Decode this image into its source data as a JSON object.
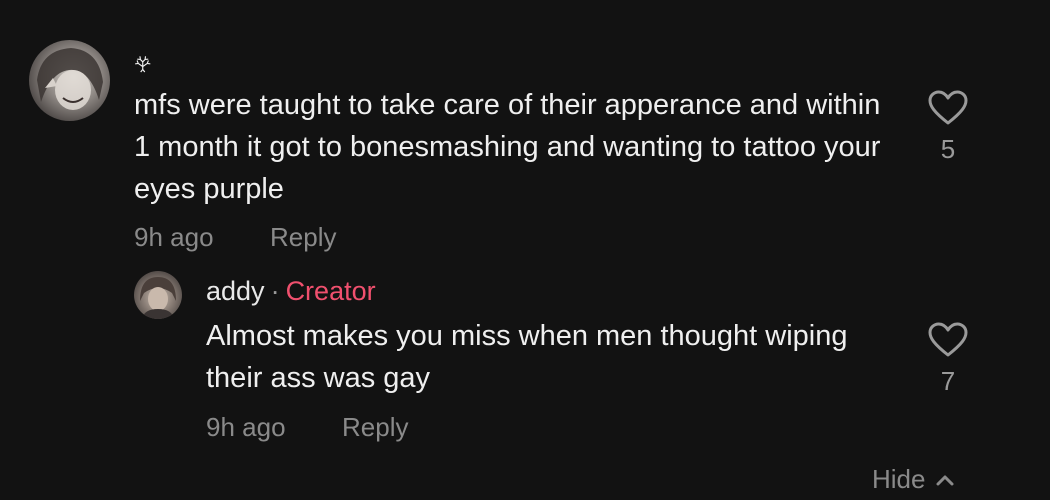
{
  "comment": {
    "username": "𖣂",
    "text": "mfs were taught to take care of their apperance and within 1 month it got to bonesmashing and wanting to tattoo your eyes purple",
    "time": "9h ago",
    "reply_label": "Reply",
    "likes": "5"
  },
  "reply": {
    "username": "addy",
    "separator": "·",
    "badge": "Creator",
    "text": "Almost makes you miss when men thought wiping their ass was gay",
    "time": "9h ago",
    "reply_label": "Reply",
    "likes": "7"
  },
  "footer": {
    "hide_label": "Hide"
  },
  "colors": {
    "background": "#121212",
    "creator": "#f0506e",
    "muted": "#8a8a8a"
  }
}
